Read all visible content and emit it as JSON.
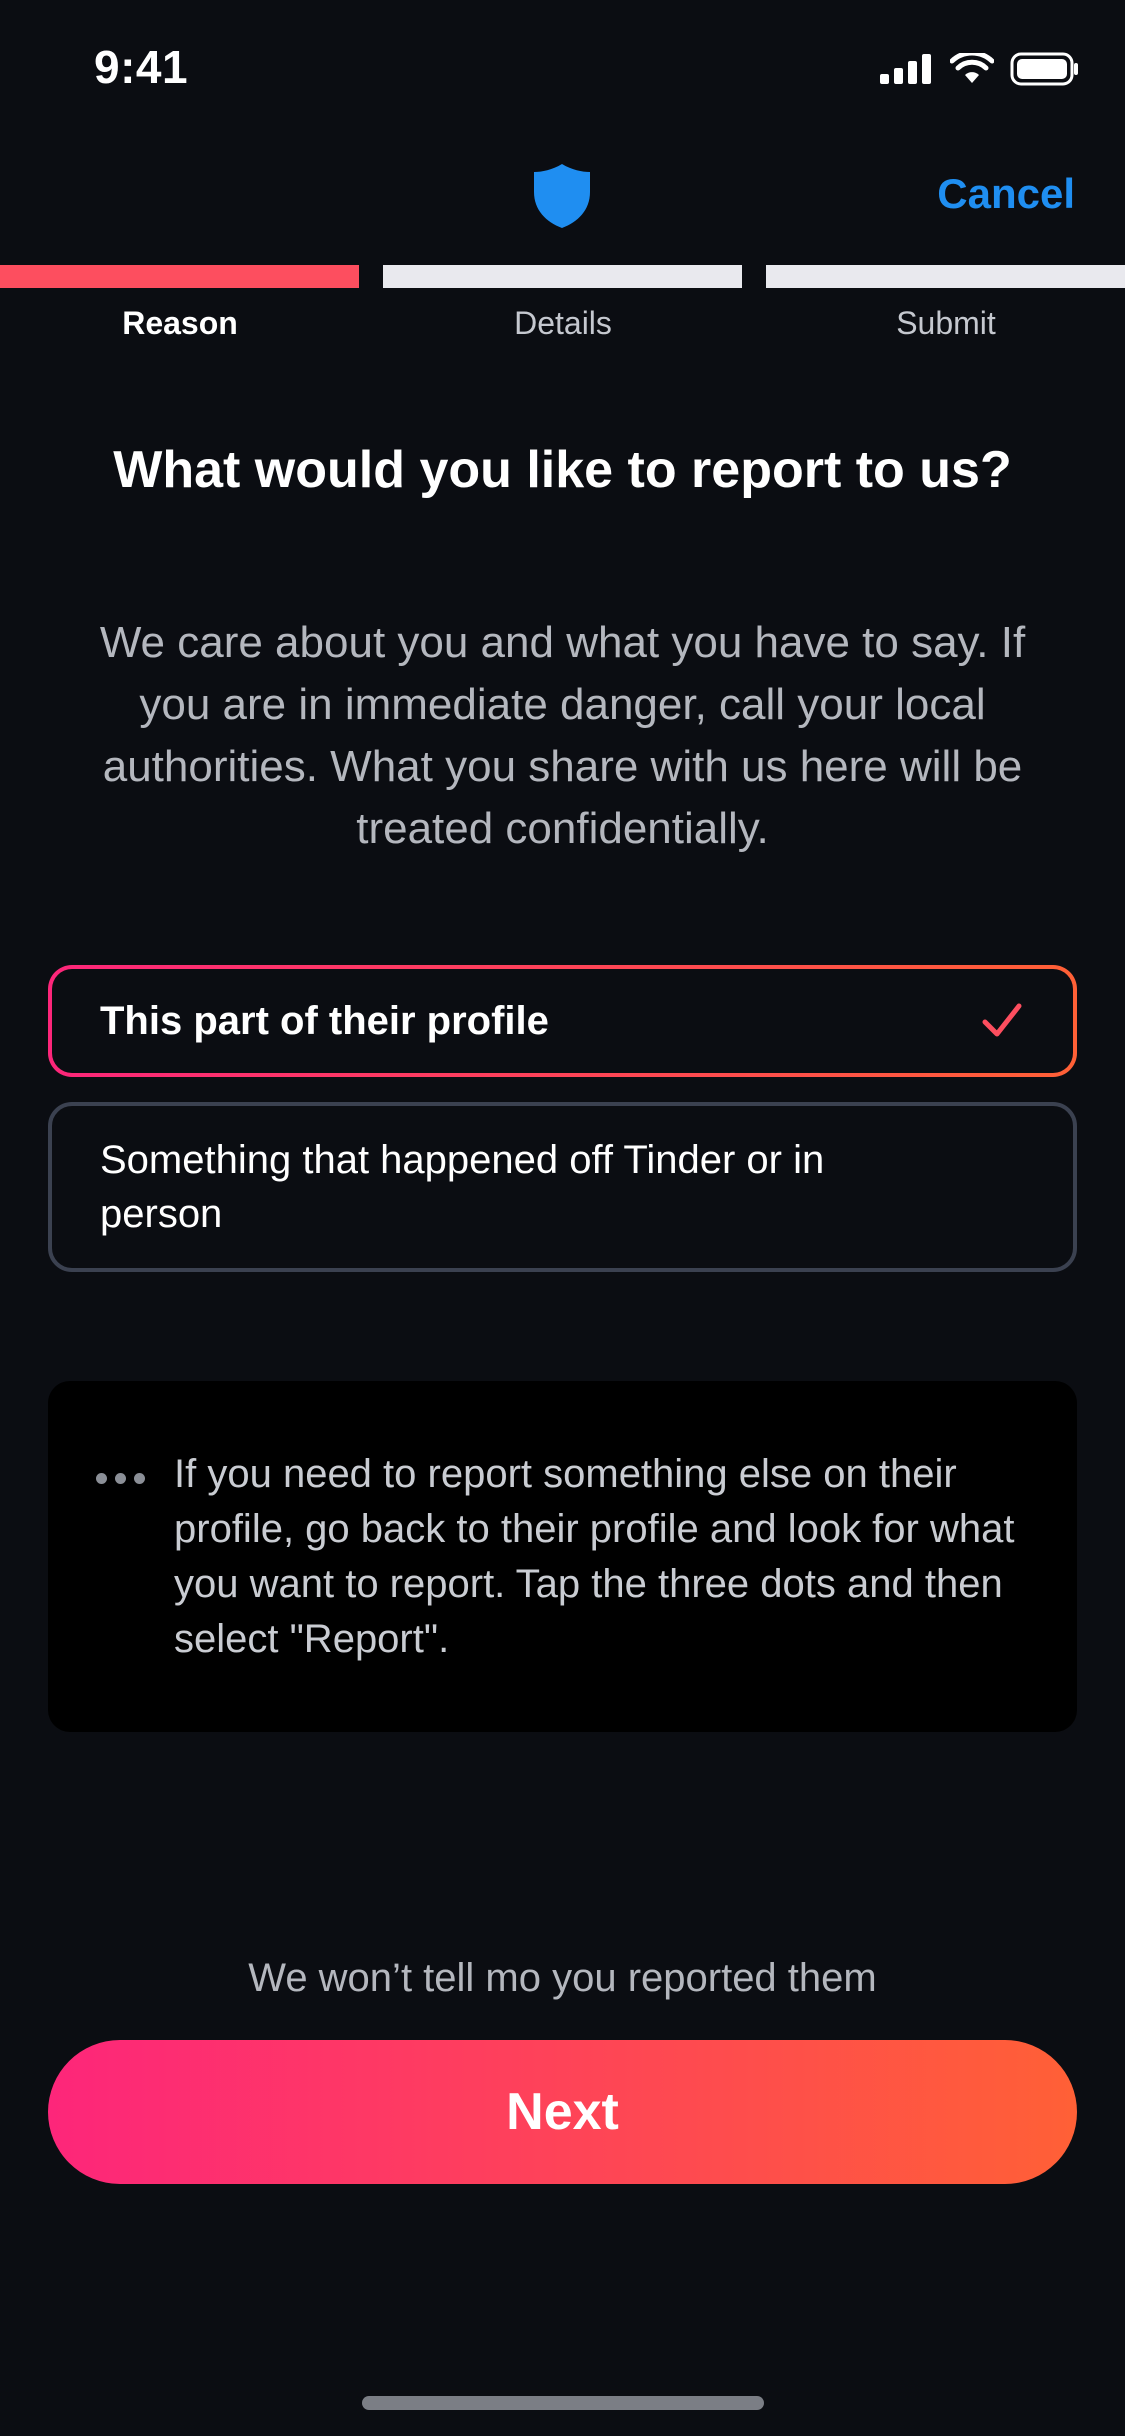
{
  "status_bar": {
    "time": "9:41",
    "icons": [
      "cellular-signal-icon",
      "wifi-icon",
      "battery-icon"
    ]
  },
  "header": {
    "icon": "shield-icon",
    "cancel_label": "Cancel"
  },
  "progress": {
    "current_step": 1,
    "steps": [
      "Reason",
      "Details",
      "Submit"
    ]
  },
  "main": {
    "title": "What would you like to report to us?",
    "description": "We care about you and what you have to say. If you are in immediate danger, call your local authorities. What you share with us here will be treated confidentially.",
    "options": [
      {
        "label": "This part of their profile",
        "selected": true
      },
      {
        "label": "Something that happened off Tinder or in person",
        "selected": false
      }
    ],
    "info": {
      "icon": "more-dots-icon",
      "text": "If you need to report something else on their profile, go back to their profile and look for what you want to report. Tap the three dots and then select \"Report\"."
    }
  },
  "footer": {
    "note": "We won’t tell mo you reported them",
    "next_label": "Next"
  },
  "colors": {
    "background": "#0b0d12",
    "accent_start": "#fd267a",
    "accent_end": "#ff6036",
    "progress_active": "#fd4e5f",
    "link_blue": "#1f8ef1"
  }
}
